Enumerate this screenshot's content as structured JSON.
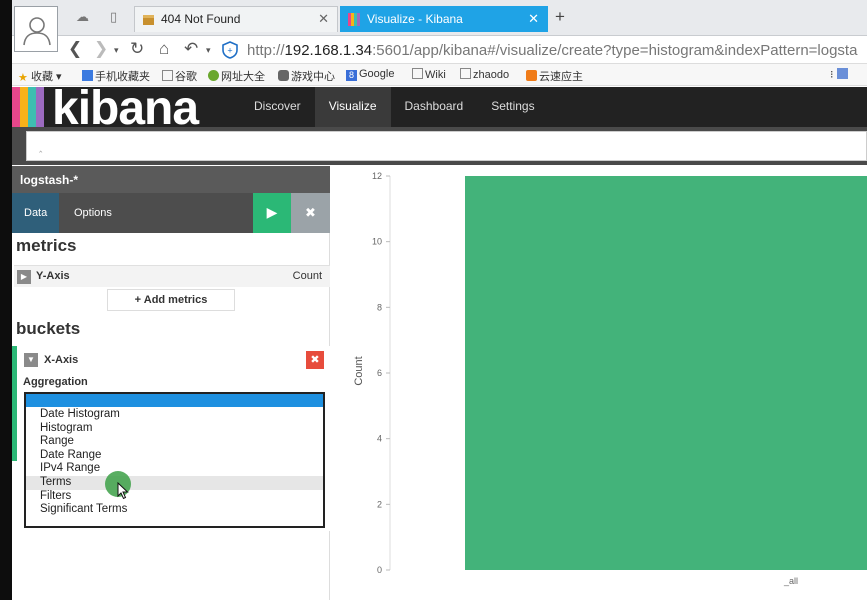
{
  "browser": {
    "tabs": [
      {
        "title": "404 Not Found",
        "active": false
      },
      {
        "title": "Visualize - Kibana",
        "active": true
      }
    ],
    "url": {
      "scheme": "http://",
      "host": "192.168.1.34",
      "rest": ":5601/app/kibana#/visualize/create?type=histogram&indexPattern=logsta"
    },
    "bookmarks": [
      "收藏",
      "手机收藏夹",
      "谷歌",
      "网址大全",
      "游戏中心",
      "Google",
      "Wiki",
      "zhaodo",
      "云速应主"
    ]
  },
  "kibana": {
    "logo": "kibana",
    "menu": [
      {
        "label": "Discover",
        "active": false
      },
      {
        "label": "Visualize",
        "active": true
      },
      {
        "label": "Dashboard",
        "active": false
      },
      {
        "label": "Settings",
        "active": false
      }
    ]
  },
  "sidebar": {
    "index_pattern": "logstash-*",
    "tabs": [
      {
        "label": "Data",
        "active": true
      },
      {
        "label": "Options",
        "active": false
      }
    ],
    "apply_icon": "▶",
    "discard_icon": "✖",
    "metrics": {
      "title": "metrics",
      "row_label": "Y-Axis",
      "row_value": "Count",
      "add_label": "+ Add metrics"
    },
    "buckets": {
      "title": "buckets",
      "axis_label": "X-Axis",
      "aggregation_label": "Aggregation",
      "options": [
        "Date Histogram",
        "Histogram",
        "Range",
        "Date Range",
        "IPv4 Range",
        "Terms",
        "Filters",
        "Significant Terms"
      ],
      "hovered_option": "Terms"
    }
  },
  "chart_data": {
    "type": "bar",
    "categories": [
      "_all"
    ],
    "values": [
      12
    ],
    "ylabel": "Count",
    "ylim": [
      0,
      12
    ],
    "yticks": [
      "0",
      "2",
      "4",
      "6",
      "8",
      "10",
      "12"
    ],
    "bar_color": "#43b37a",
    "grid": false
  },
  "colors": {
    "accent_blue": "#1fa3e6",
    "apply_green": "#2bb876",
    "remove_red": "#e74c3c"
  }
}
